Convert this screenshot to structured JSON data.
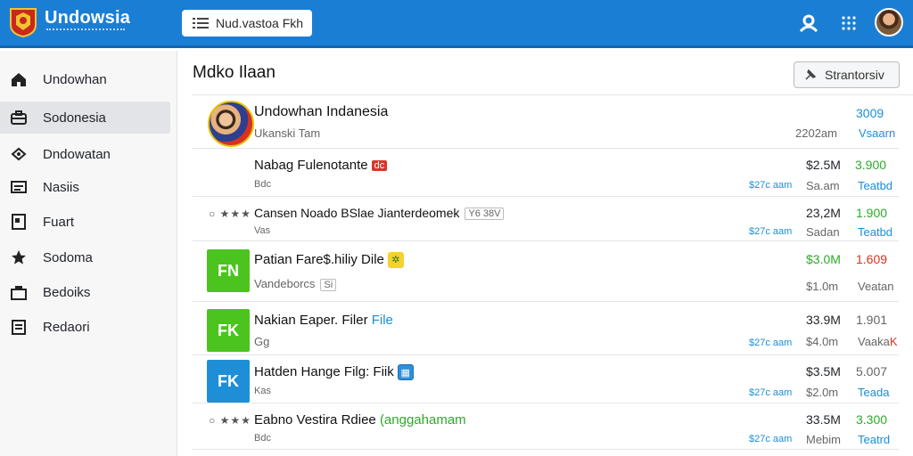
{
  "app": {
    "brand": "Undowsia"
  },
  "search": {
    "value": "Nud.vastoa Fkh"
  },
  "sidebar": {
    "items": [
      {
        "label": "Undowhan",
        "icon": "home-icon"
      },
      {
        "label": "Sodonesia",
        "icon": "briefcase-icon"
      },
      {
        "label": "Dndowatan",
        "icon": "network-icon"
      },
      {
        "label": "Nasiis",
        "icon": "list-icon"
      },
      {
        "label": "Fuart",
        "icon": "document-icon"
      },
      {
        "label": "Sodoma",
        "icon": "star-icon"
      },
      {
        "label": "Bedoiks",
        "icon": "box-icon"
      },
      {
        "label": "Redaori",
        "icon": "clipboard-icon"
      }
    ]
  },
  "main": {
    "title": "Mdko Ilaan",
    "action_label": "Strantorsiv",
    "rows": [
      {
        "title": "Undowhan Indanesia",
        "sub": "Ukanski Tam",
        "right_top": "3009",
        "right_mid": "2202am",
        "right_bot": "Vsaarn"
      },
      {
        "title": "Nabag Fulenotante",
        "badge": "dc",
        "sub": "Bdc",
        "mid": "$27c aam",
        "val1": "$2.5M",
        "val2": "3.900",
        "val3": "Sa.am",
        "val4": "Teatbd"
      },
      {
        "title": "Cansen Noado BSlae Jianterdeomek",
        "badge": "Y6 38V",
        "sub": "Vas",
        "mid": "$27c aam",
        "val1": "23,2M",
        "val2": "1.900",
        "val3": "Sadan",
        "val4": "Teatbd"
      },
      {
        "tile": "FN",
        "title": "Patian Fare$.hiliy Dile",
        "sub": "Vandeborcs",
        "sub_badge": "Si",
        "val1": "$3.0M",
        "val2": "1.609",
        "val3": "$1.0m",
        "val4": "Veatan"
      },
      {
        "tile": "FK",
        "title": "Nakian Eaper. Filer",
        "title_extra": "File",
        "sub": "Gg",
        "mid": "$27c aam",
        "val1": "33.9M",
        "val2": "1.901",
        "val3": "$4.0m",
        "val4": "Vaaka",
        "val4_extra": "K"
      },
      {
        "tile": "FK",
        "title": "Hatden Hange Filg: Fiik",
        "sub": "Kas",
        "mid": "$27c aam",
        "val1": "$3.5M",
        "val2": "5.007",
        "val3": "$2.0m",
        "val4": "Teada"
      },
      {
        "title": "Eabno Vestira Rdiee",
        "title_extra": "(anggahamam",
        "sub": "Bdc",
        "mid": "$27c aam",
        "val1": "33.5M",
        "val2": "3.300",
        "val3": "Mebim",
        "val4": "Teatrd"
      }
    ]
  },
  "colors": {
    "topbar": "#1a7fd4",
    "accent_blue": "#1a8fd6",
    "accent_green": "#2daa2a",
    "accent_red": "#d8341f"
  }
}
